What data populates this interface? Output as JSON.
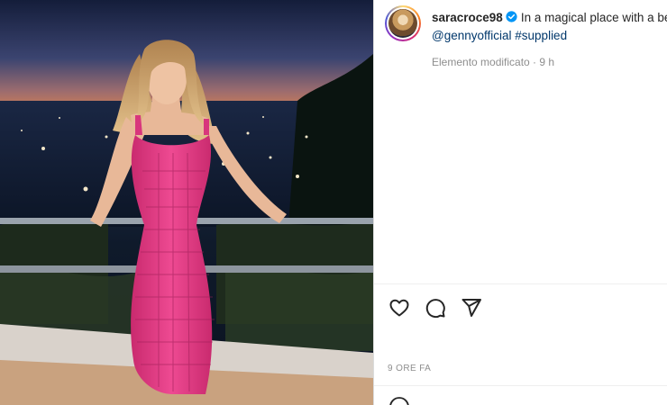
{
  "post": {
    "username": "saracroce98",
    "verified": true,
    "caption_text": "In a magical place with a beautiful",
    "mention": "@gennyofficial",
    "hashtag": "#supplied",
    "meta": "Elemento modificato · 9 h",
    "timestamp": "9 ORE FA"
  },
  "icons": {
    "like": "heart-icon",
    "comment": "comment-icon",
    "share": "paper-plane-icon",
    "verified": "verified-badge-icon",
    "emoji": "emoji-icon"
  },
  "colors": {
    "text": "#262626",
    "muted": "#8e8e8e",
    "link": "#00376b",
    "verified": "#0095f6",
    "dress": "#e0347f"
  }
}
